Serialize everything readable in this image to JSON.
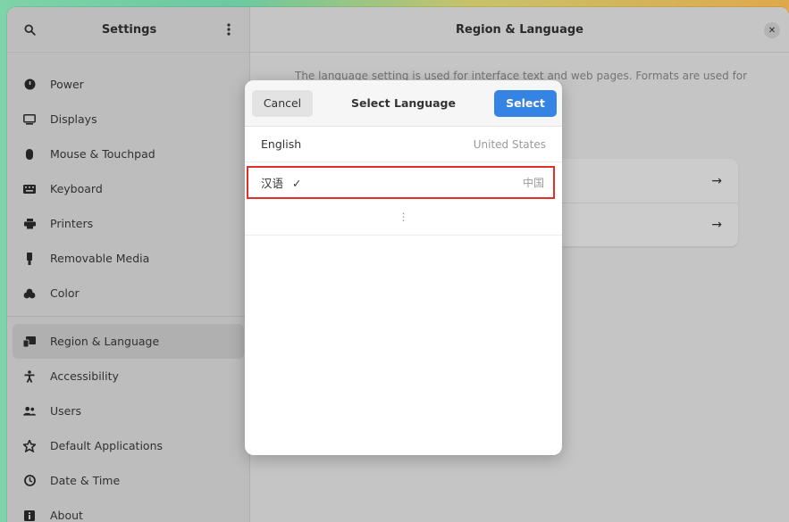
{
  "sidebar": {
    "title": "Settings",
    "items": [
      {
        "label": "Power",
        "icon": "power-icon"
      },
      {
        "label": "Displays",
        "icon": "display-icon"
      },
      {
        "label": "Mouse & Touchpad",
        "icon": "mouse-icon"
      },
      {
        "label": "Keyboard",
        "icon": "keyboard-icon"
      },
      {
        "label": "Printers",
        "icon": "printer-icon"
      },
      {
        "label": "Removable Media",
        "icon": "usb-icon"
      },
      {
        "label": "Color",
        "icon": "color-icon"
      },
      {
        "label": "Region & Language",
        "icon": "region-icon"
      },
      {
        "label": "Accessibility",
        "icon": "accessibility-icon"
      },
      {
        "label": "Users",
        "icon": "users-icon"
      },
      {
        "label": "Default Applications",
        "icon": "star-icon"
      },
      {
        "label": "Date & Time",
        "icon": "clock-icon"
      },
      {
        "label": "About",
        "icon": "about-icon"
      }
    ]
  },
  "main": {
    "title": "Region & Language",
    "description": "The language setting is used for interface text and web pages. Formats are used for",
    "rows": [
      {
        "arrow": "→"
      },
      {
        "arrow": "→"
      }
    ]
  },
  "dialog": {
    "title": "Select Language",
    "cancel_label": "Cancel",
    "select_label": "Select",
    "languages": [
      {
        "name": "English",
        "region": "United States"
      },
      {
        "name": "汉语",
        "region": "中国",
        "selected": true,
        "check": "✓"
      }
    ],
    "more": "⋮"
  },
  "colors": {
    "accent": "#3584e4",
    "highlight": "#e0302a"
  }
}
